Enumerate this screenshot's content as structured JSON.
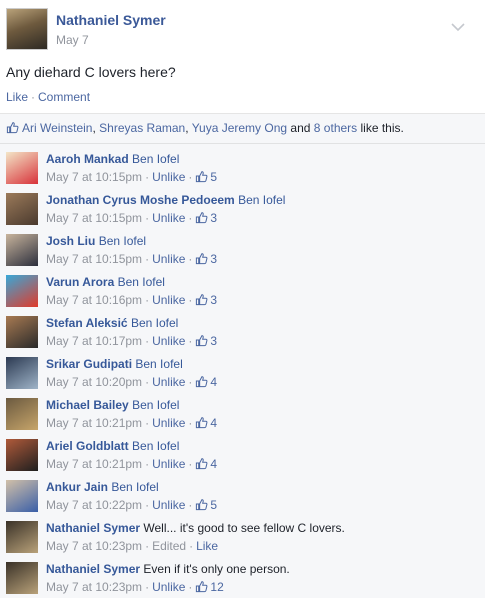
{
  "post": {
    "author": "Nathaniel Symer",
    "date": "May 7",
    "text": "Any diehard C lovers here?",
    "actions": {
      "like": "Like",
      "separator": "·",
      "comment": "Comment"
    }
  },
  "likes": {
    "names": [
      "Ari Weinstein",
      "Shreyas Raman",
      "Yuya Jeremy Ong"
    ],
    "comma": ",",
    "and": "and",
    "others": "8 others",
    "suffix": "like this."
  },
  "comments": [
    {
      "author": "Aaroh Mankad",
      "text": "",
      "tag": "Ben Iofel",
      "time": "May 7 at 10:15pm",
      "action": "Unlike",
      "likes": "5"
    },
    {
      "author": "Jonathan Cyrus Moshe Pedoeem",
      "text": "",
      "tag": "Ben Iofel",
      "time": "May 7 at 10:15pm",
      "action": "Unlike",
      "likes": "3"
    },
    {
      "author": "Josh Liu",
      "text": "",
      "tag": "Ben Iofel",
      "time": "May 7 at 10:15pm",
      "action": "Unlike",
      "likes": "3"
    },
    {
      "author": "Varun Arora",
      "text": "",
      "tag": "Ben Iofel",
      "time": "May 7 at 10:16pm",
      "action": "Unlike",
      "likes": "3"
    },
    {
      "author": "Stefan Aleksić",
      "text": "",
      "tag": "Ben Iofel",
      "time": "May 7 at 10:17pm",
      "action": "Unlike",
      "likes": "3"
    },
    {
      "author": "Srikar Gudipati",
      "text": "",
      "tag": "Ben Iofel",
      "time": "May 7 at 10:20pm",
      "action": "Unlike",
      "likes": "4"
    },
    {
      "author": "Michael Bailey",
      "text": "",
      "tag": "Ben Iofel",
      "time": "May 7 at 10:21pm",
      "action": "Unlike",
      "likes": "4"
    },
    {
      "author": "Ariel Goldblatt",
      "text": "",
      "tag": "Ben Iofel",
      "time": "May 7 at 10:21pm",
      "action": "Unlike",
      "likes": "4"
    },
    {
      "author": "Ankur Jain",
      "text": "",
      "tag": "Ben Iofel",
      "time": "May 7 at 10:22pm",
      "action": "Unlike",
      "likes": "5"
    },
    {
      "author": "Nathaniel Symer",
      "text": "Well... it's good to see fellow C lovers.",
      "tag": "",
      "time": "May 7 at 10:23pm",
      "edited": "Edited",
      "action": "Like",
      "likes": ""
    },
    {
      "author": "Nathaniel Symer",
      "text": "Even if it's only one person.",
      "tag": "",
      "time": "May 7 at 10:23pm",
      "action": "Unlike",
      "likes": "12"
    }
  ],
  "icons": {
    "chevron": "chevron-down-icon",
    "thumb": "thumbs-up-icon"
  },
  "colors": {
    "link": "#365899",
    "meta": "#90949c",
    "ufi_bg": "#f6f7f9"
  }
}
